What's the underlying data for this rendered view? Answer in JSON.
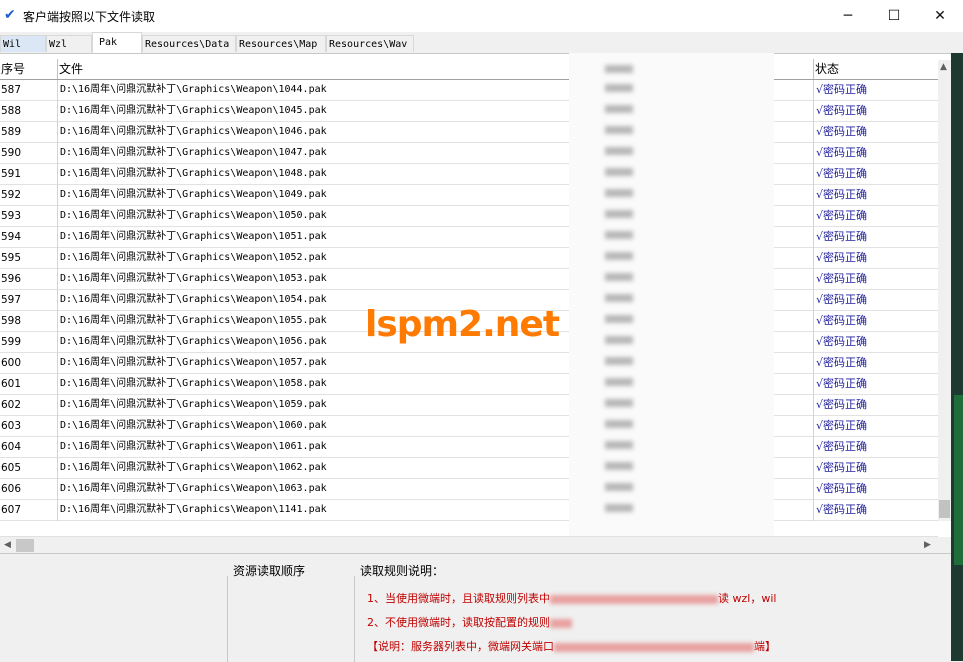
{
  "window": {
    "title": "客户端按照以下文件读取",
    "icon": "checkmark-icon",
    "buttons": {
      "minimize": "─",
      "maximize": "☐",
      "close": "✕"
    }
  },
  "tabs": [
    {
      "label": "Wil"
    },
    {
      "label": "Wzl"
    },
    {
      "label": "Pak"
    },
    {
      "label": "Resources\\Data"
    },
    {
      "label": "Resources\\Map"
    },
    {
      "label": "Resources\\Wav"
    }
  ],
  "table": {
    "headers": {
      "no": "序号",
      "file": "文件",
      "status": "状态"
    },
    "rows": [
      {
        "no": "587",
        "file": "D:\\16周年\\问鼎沉默补丁\\Graphics\\Weapon\\1044.pak",
        "status": "√密码正确"
      },
      {
        "no": "588",
        "file": "D:\\16周年\\问鼎沉默补丁\\Graphics\\Weapon\\1045.pak",
        "status": "√密码正确"
      },
      {
        "no": "589",
        "file": "D:\\16周年\\问鼎沉默补丁\\Graphics\\Weapon\\1046.pak",
        "status": "√密码正确"
      },
      {
        "no": "590",
        "file": "D:\\16周年\\问鼎沉默补丁\\Graphics\\Weapon\\1047.pak",
        "status": "√密码正确"
      },
      {
        "no": "591",
        "file": "D:\\16周年\\问鼎沉默补丁\\Graphics\\Weapon\\1048.pak",
        "status": "√密码正确"
      },
      {
        "no": "592",
        "file": "D:\\16周年\\问鼎沉默补丁\\Graphics\\Weapon\\1049.pak",
        "status": "√密码正确"
      },
      {
        "no": "593",
        "file": "D:\\16周年\\问鼎沉默补丁\\Graphics\\Weapon\\1050.pak",
        "status": "√密码正确"
      },
      {
        "no": "594",
        "file": "D:\\16周年\\问鼎沉默补丁\\Graphics\\Weapon\\1051.pak",
        "status": "√密码正确"
      },
      {
        "no": "595",
        "file": "D:\\16周年\\问鼎沉默补丁\\Graphics\\Weapon\\1052.pak",
        "status": "√密码正确"
      },
      {
        "no": "596",
        "file": "D:\\16周年\\问鼎沉默补丁\\Graphics\\Weapon\\1053.pak",
        "status": "√密码正确"
      },
      {
        "no": "597",
        "file": "D:\\16周年\\问鼎沉默补丁\\Graphics\\Weapon\\1054.pak",
        "status": "√密码正确"
      },
      {
        "no": "598",
        "file": "D:\\16周年\\问鼎沉默补丁\\Graphics\\Weapon\\1055.pak",
        "status": "√密码正确"
      },
      {
        "no": "599",
        "file": "D:\\16周年\\问鼎沉默补丁\\Graphics\\Weapon\\1056.pak",
        "status": "√密码正确"
      },
      {
        "no": "600",
        "file": "D:\\16周年\\问鼎沉默补丁\\Graphics\\Weapon\\1057.pak",
        "status": "√密码正确"
      },
      {
        "no": "601",
        "file": "D:\\16周年\\问鼎沉默补丁\\Graphics\\Weapon\\1058.pak",
        "status": "√密码正确"
      },
      {
        "no": "602",
        "file": "D:\\16周年\\问鼎沉默补丁\\Graphics\\Weapon\\1059.pak",
        "status": "√密码正确"
      },
      {
        "no": "603",
        "file": "D:\\16周年\\问鼎沉默补丁\\Graphics\\Weapon\\1060.pak",
        "status": "√密码正确"
      },
      {
        "no": "604",
        "file": "D:\\16周年\\问鼎沉默补丁\\Graphics\\Weapon\\1061.pak",
        "status": "√密码正确"
      },
      {
        "no": "605",
        "file": "D:\\16周年\\问鼎沉默补丁\\Graphics\\Weapon\\1062.pak",
        "status": "√密码正确"
      },
      {
        "no": "606",
        "file": "D:\\16周年\\问鼎沉默补丁\\Graphics\\Weapon\\1063.pak",
        "status": "√密码正确"
      },
      {
        "no": "607",
        "file": "D:\\16周年\\问鼎沉默补丁\\Graphics\\Weapon\\1141.pak",
        "status": "√密码正确"
      }
    ]
  },
  "bottom": {
    "order_label": "资源读取顺序",
    "rules_title": "读取规则说明：",
    "rule1_start": "1、当使用微端时，且读取规则列表中",
    "rule1_end": "读 wzl，wil",
    "rule2_start": "2、不使用微端时，读取按配置的规则",
    "rule3_start": "【说明：服务器列表中，微端网关端口",
    "rule3_end": "端】"
  },
  "watermark": "lspm2.net",
  "colors": {
    "status_text": "#1c1c9c",
    "rule_text": "#c00000",
    "watermark": "#ff7a00"
  }
}
